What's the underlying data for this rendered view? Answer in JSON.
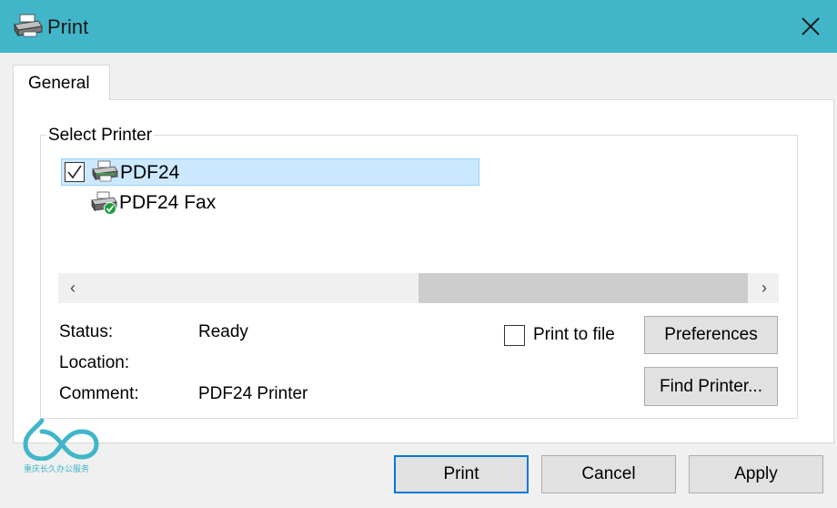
{
  "window": {
    "title": "Print",
    "title_icon": "printer-icon",
    "close_icon": "close-icon",
    "titlebar_color": "#41b6c9"
  },
  "tabs": [
    {
      "label": "General",
      "selected": true
    }
  ],
  "select_printer": {
    "legend": "Select Printer",
    "printers": [
      {
        "name": "PDF24",
        "selected": true,
        "icon": "printer-icon"
      },
      {
        "name": "PDF24 Fax",
        "selected": false,
        "icon": "default-printer-icon"
      }
    ]
  },
  "scrollbar": {
    "left_arrow": "‹",
    "right_arrow": "›"
  },
  "info": {
    "status_label": "Status:",
    "status_value": "Ready",
    "location_label": "Location:",
    "location_value": "",
    "comment_label": "Comment:",
    "comment_value": "PDF24 Printer"
  },
  "print_to_file": {
    "label": "Print to file",
    "checked": false
  },
  "buttons": {
    "preferences": "Preferences",
    "find_printer": "Find Printer...",
    "print": "Print",
    "cancel": "Cancel",
    "apply": "Apply"
  },
  "watermark": {
    "text": "重庆长久办公服务"
  },
  "colors": {
    "selection_bg": "#cce8ff",
    "selection_border": "#99d1ff",
    "default_button_border": "#0078d7"
  }
}
